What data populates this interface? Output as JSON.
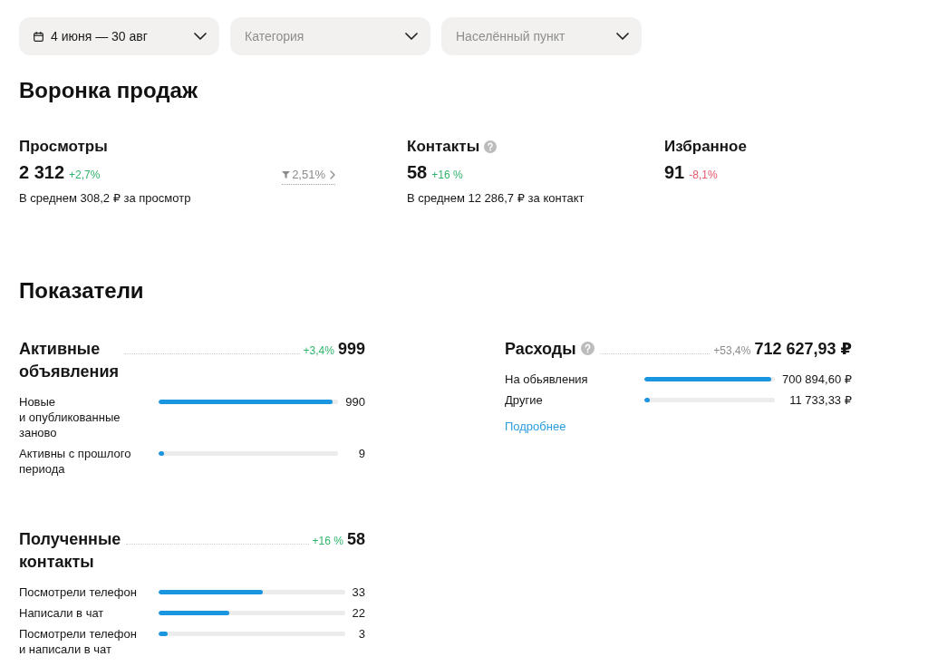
{
  "filters": [
    {
      "kind": "date",
      "value": "4 июня — 30 авг"
    },
    {
      "kind": "select",
      "placeholder": "Категория"
    },
    {
      "kind": "select",
      "placeholder": "Населённый пункт"
    }
  ],
  "funnel": {
    "title": "Воронка продаж",
    "metrics": [
      {
        "label": "Просмотры",
        "help": false,
        "value": "2 312",
        "change": "+2,7%",
        "color": "#2fb36b",
        "conversion": "2,51%",
        "note": "В среднем 308,2 ₽ за просмотр"
      },
      {
        "label": "Контакты",
        "help": true,
        "value": "58",
        "change": "+16 %",
        "color": "#2fb36b",
        "note": "В среднем 12 286,7 ₽ за контакт"
      },
      {
        "label": "Избранное",
        "help": false,
        "value": "91",
        "change": "-8,1%",
        "color": "#e5566c"
      }
    ]
  },
  "indicators": {
    "title": "Показатели",
    "blocks": [
      {
        "title": "Активные объявления",
        "help": false,
        "change": "+3,4%",
        "color": "#2fb36b",
        "total": "999",
        "rows": [
          {
            "label": "Новые и опубликованные заново",
            "level": 0.97,
            "value": "990"
          },
          {
            "label": "Активны с прошлого периода",
            "level": 0.03,
            "value": "9"
          }
        ]
      },
      {
        "title": "Расходы",
        "help": true,
        "change": "+53,4%",
        "color": "#8c8c8c",
        "total": "712 627,93 ₽",
        "rows": [
          {
            "label": "На обьявления",
            "level": 0.97,
            "value": "700 894,60 ₽"
          },
          {
            "label": "Другие",
            "level": 0.04,
            "value": "11 733,33 ₽"
          }
        ],
        "link": "Подробнее"
      },
      {
        "title": "Полученные контакты",
        "help": false,
        "change": "+16 %",
        "color": "#2fb36b",
        "total": "58",
        "rows": [
          {
            "label": "Посмотрели телефон",
            "level": 0.56,
            "value": "33"
          },
          {
            "label": "Написали в чат",
            "level": 0.38,
            "value": "22"
          },
          {
            "label": "Посмотрели телефон и написали в чат",
            "level": 0.05,
            "value": "3"
          }
        ]
      }
    ]
  }
}
